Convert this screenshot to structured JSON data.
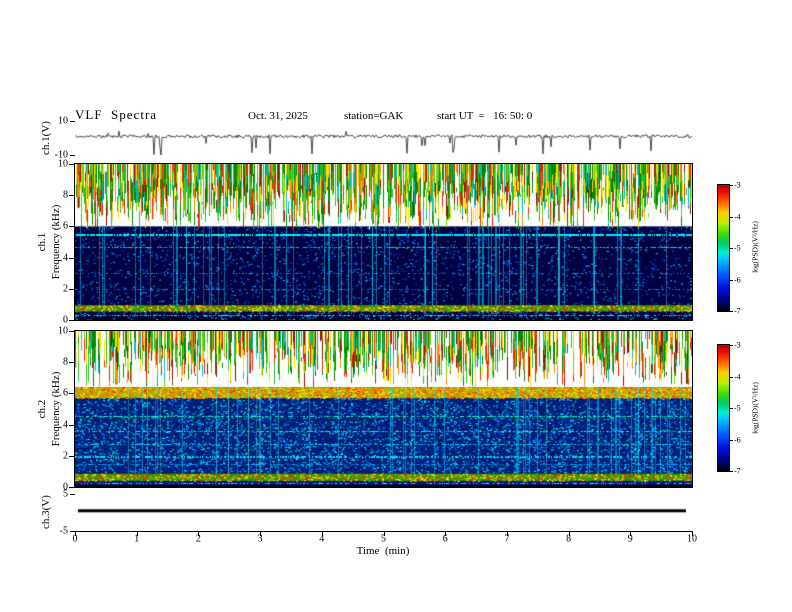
{
  "header": {
    "title": "VLF  Spectra",
    "date": "Oct. 31, 2025",
    "station": "station=GAK",
    "start_ut": "start UT  =   16: 50: 0"
  },
  "axes": {
    "time_label": "Time  (min)",
    "time_ticks": [
      0,
      1,
      2,
      3,
      4,
      5,
      6,
      7,
      8,
      9,
      10
    ],
    "freq_ticks": [
      0,
      2,
      4,
      6,
      8,
      10
    ],
    "ch1_wave_label": "ch.1(V)",
    "ch1_wave_ticks": [
      10,
      -10
    ],
    "ch1_spec_channel": "ch.1",
    "ch1_spec_freq_label": "Frequency  (kHz)",
    "ch2_spec_channel": "ch.2",
    "ch2_spec_freq_label": "Frequency  (kHz)",
    "ch3_label": "ch.3(V)",
    "ch3_ticks": [
      5,
      -5
    ]
  },
  "colorbar": {
    "label": "log(PSD)(V²/Hz)",
    "ticks": [
      -3,
      -4,
      -5,
      -6,
      -7
    ],
    "range": [
      -7,
      -3
    ],
    "gradient": [
      {
        "color": "#bb0000",
        "pos": 0
      },
      {
        "color": "#ee1100",
        "pos": 6
      },
      {
        "color": "#ff6600",
        "pos": 14
      },
      {
        "color": "#ffcc00",
        "pos": 22
      },
      {
        "color": "#bbee00",
        "pos": 30
      },
      {
        "color": "#44dd00",
        "pos": 38
      },
      {
        "color": "#00cc66",
        "pos": 46
      },
      {
        "color": "#00eedd",
        "pos": 54
      },
      {
        "color": "#00aaff",
        "pos": 62
      },
      {
        "color": "#0055ff",
        "pos": 72
      },
      {
        "color": "#0011dd",
        "pos": 82
      },
      {
        "color": "#000077",
        "pos": 92
      },
      {
        "color": "#000011",
        "pos": 100
      }
    ]
  },
  "chart_data": [
    {
      "type": "line",
      "title": "ch.1 time series",
      "xlabel": "Time (min)",
      "ylabel": "ch.1(V)",
      "xlim": [
        0,
        10
      ],
      "ylim": [
        -10,
        10
      ],
      "description": "Noisy broadband signal fluctuating around +1 V with frequent impulsive downward spikes (sferics) reaching -5 to -10 V throughout the 10-minute record.",
      "baseline": 1.0,
      "noise_amplitude": 0.9,
      "spike_probability": 0.03,
      "spike_depth_range": [
        2.5,
        10
      ],
      "up_spike_probability": 0.008,
      "up_spike_range": [
        2,
        4
      ]
    },
    {
      "type": "heatmap",
      "title": "ch.1 VLF spectrogram",
      "xlabel": "Time (min)",
      "ylabel": "Frequency (kHz)",
      "xlim": [
        0,
        10
      ],
      "ylim": [
        0,
        10
      ],
      "zlabel": "log(PSD)(V²/Hz)",
      "zlim": [
        -7,
        -3
      ],
      "features": [
        "dense vertical impulsive streaks (sferics) above ~6 kHz with green/yellow/red intensities (-5 to -3) on a white low-power background",
        "dark blue background (-6.5 to -7) from 1 to 6 kHz with scattered cyan speckle",
        "narrow cyan horizontal line near 5.5 kHz and weaker lines near 4.7, 3 and 2 kHz",
        "many faint cyan vertical lines crossing the low-frequency band",
        "bright yellow/green/red power band between about 0.5 and 1 kHz",
        "dark band at the very bottom below 0.2 kHz"
      ],
      "render_bands": [
        {
          "style": "fill",
          "f0": 0,
          "f1": 10,
          "color": "#000044"
        },
        {
          "style": "fill",
          "f0": 6,
          "f1": 10,
          "color": "#ffffff"
        },
        {
          "style": "vstreaks",
          "f0": 6,
          "f1": 10,
          "density": 0.85,
          "min_len": 0.4,
          "max_len": 1.05,
          "colors": [
            [
              "#008800",
              0.22
            ],
            [
              "#22bb22",
              0.16
            ],
            [
              "#77cc00",
              0.1
            ],
            [
              "#ffdd00",
              0.12
            ],
            [
              "#ff8800",
              0.09
            ],
            [
              "#ee2200",
              0.09
            ],
            [
              "#881100",
              0.06
            ],
            [
              "#00bbbb",
              0.09
            ],
            [
              "#ffffff",
              0.07
            ]
          ]
        },
        {
          "style": "speckle",
          "f0": 1.0,
          "f1": 6.0,
          "density": 0.1,
          "colors": [
            [
              "#0044cc",
              0.35
            ],
            [
              "#0077ee",
              0.3
            ],
            [
              "#00bbff",
              0.2
            ],
            [
              "#001a66",
              0.15
            ]
          ]
        },
        {
          "style": "speckle",
          "f0": 1.0,
          "f1": 6.0,
          "density": 0.05,
          "colors": [
            [
              "#000022",
              1
            ]
          ]
        },
        {
          "style": "hline",
          "f": 5.5,
          "px": 2,
          "density": 0.8,
          "color": "#00eeff"
        },
        {
          "style": "hline",
          "f": 4.7,
          "px": 1,
          "density": 0.55,
          "color": "#00dd99"
        },
        {
          "style": "hline",
          "f": 3.0,
          "px": 1,
          "density": 0.3,
          "color": "#0099ff"
        },
        {
          "style": "hline",
          "f": 2.0,
          "px": 1,
          "density": 0.3,
          "color": "#0099ff"
        },
        {
          "style": "vlines",
          "count": 60,
          "f0": 0.4,
          "f1": 6.0,
          "alpha": 0.5,
          "color": "#00e5ff"
        },
        {
          "style": "vlines",
          "count": 14,
          "f0": 0.4,
          "f1": 10,
          "alpha": 0.3,
          "color": "#aaffee"
        },
        {
          "style": "fill",
          "f0": 0.55,
          "f1": 0.95,
          "color": "#4d8800"
        },
        {
          "style": "speckle",
          "f0": 0.55,
          "f1": 0.95,
          "density": 0.55,
          "colors": [
            [
              "#ffee00",
              0.4
            ],
            [
              "#ff7700",
              0.18
            ],
            [
              "#ff1100",
              0.12
            ],
            [
              "#22cc00",
              0.3
            ]
          ]
        },
        {
          "style": "hline",
          "f": 0.35,
          "px": 1,
          "density": 0.45,
          "color": "#00ffff"
        },
        {
          "style": "fill",
          "f0": 0,
          "f1": 0.18,
          "color": "#000022"
        },
        {
          "style": "speckle",
          "f0": 0,
          "f1": 0.5,
          "density": 0.12,
          "colors": [
            [
              "#0066cc",
              0.6
            ],
            [
              "#00ccff",
              0.4
            ]
          ]
        }
      ]
    },
    {
      "type": "heatmap",
      "title": "ch.2 VLF spectrogram",
      "xlabel": "Time (min)",
      "ylabel": "Frequency (kHz)",
      "xlim": [
        0,
        10
      ],
      "ylim": [
        0,
        10
      ],
      "zlabel": "log(PSD)(V²/Hz)",
      "zlim": [
        -7,
        -3
      ],
      "features": [
        "vertical impulsive streaks above ~6.4 kHz, slightly sparser than ch.1, on a white background",
        "strong continuous yellow/orange/green power band between about 5.7 and 6.4 kHz",
        "medium-blue background from 1 to 5.7 kHz with heavy cyan speckle",
        "horizontal cyan/green lines near 4.5, 3.6, 2.8, 2.0 and 1.4 kHz",
        "many faint cyan vertical lines crossing the low-frequency band",
        "bright yellow/green band between about 0.4 and 0.85 kHz",
        "dark band at the very bottom below 0.15 kHz"
      ],
      "render_bands": [
        {
          "style": "fill",
          "f0": 0,
          "f1": 10,
          "color": "#001f7a"
        },
        {
          "style": "fill",
          "f0": 6.4,
          "f1": 10,
          "color": "#ffffff"
        },
        {
          "style": "vstreaks",
          "f0": 6.4,
          "f1": 10,
          "density": 0.72,
          "min_len": 0.3,
          "max_len": 1.0,
          "colors": [
            [
              "#008800",
              0.2
            ],
            [
              "#22bb22",
              0.15
            ],
            [
              "#77cc00",
              0.08
            ],
            [
              "#ffdd00",
              0.13
            ],
            [
              "#ff8800",
              0.1
            ],
            [
              "#ee2200",
              0.11
            ],
            [
              "#881100",
              0.07
            ],
            [
              "#00bbbb",
              0.09
            ],
            [
              "#ffffff",
              0.07
            ]
          ]
        },
        {
          "style": "fill",
          "f0": 5.7,
          "f1": 6.4,
          "color": "#b8a400"
        },
        {
          "style": "speckle",
          "f0": 5.7,
          "f1": 6.4,
          "density": 0.8,
          "colors": [
            [
              "#ff8800",
              0.28
            ],
            [
              "#ffee00",
              0.3
            ],
            [
              "#88cc00",
              0.22
            ],
            [
              "#ff2200",
              0.2
            ]
          ]
        },
        {
          "style": "speckle",
          "f0": 0.9,
          "f1": 5.7,
          "density": 0.2,
          "colors": [
            [
              "#00eeff",
              0.25
            ],
            [
              "#0099ff",
              0.3
            ],
            [
              "#0055ee",
              0.28
            ],
            [
              "#00ddbb",
              0.17
            ]
          ]
        },
        {
          "style": "speckle",
          "f0": 0.9,
          "f1": 5.7,
          "density": 0.05,
          "colors": [
            [
              "#001144",
              1
            ]
          ]
        },
        {
          "style": "hline",
          "f": 4.55,
          "px": 1,
          "density": 0.6,
          "color": "#00ffbb"
        },
        {
          "style": "hline",
          "f": 3.6,
          "px": 1,
          "density": 0.5,
          "color": "#00eeff"
        },
        {
          "style": "hline",
          "f": 2.75,
          "px": 1,
          "density": 0.5,
          "color": "#00ccff"
        },
        {
          "style": "hline",
          "f": 2.0,
          "px": 2,
          "density": 0.5,
          "color": "#00ddee"
        },
        {
          "style": "hline",
          "f": 1.45,
          "px": 1,
          "density": 0.45,
          "color": "#0099ff"
        },
        {
          "style": "vlines",
          "count": 50,
          "f0": 0.35,
          "f1": 6.4,
          "alpha": 0.45,
          "color": "#00e5ff"
        },
        {
          "style": "vlines",
          "count": 10,
          "f0": 0.35,
          "f1": 10,
          "alpha": 0.3,
          "color": "#88ffdd"
        },
        {
          "style": "fill",
          "f0": 0.4,
          "f1": 0.85,
          "color": "#558800"
        },
        {
          "style": "speckle",
          "f0": 0.4,
          "f1": 0.85,
          "density": 0.5,
          "colors": [
            [
              "#ffee00",
              0.38
            ],
            [
              "#ff7700",
              0.17
            ],
            [
              "#22cc00",
              0.33
            ],
            [
              "#ff1100",
              0.12
            ]
          ]
        },
        {
          "style": "hline",
          "f": 0.25,
          "px": 1,
          "density": 0.4,
          "color": "#00ffff"
        },
        {
          "style": "fill",
          "f0": 0,
          "f1": 0.15,
          "color": "#000022"
        }
      ]
    },
    {
      "type": "line",
      "title": "ch.3 time series",
      "xlabel": "Time (min)",
      "ylabel": "ch.3(V)",
      "xlim": [
        0,
        10
      ],
      "ylim": [
        -5,
        5
      ],
      "description": "Flat constant trace at about +0.5 V for the whole record (no signal on channel 3).",
      "value": 0.6
    }
  ]
}
